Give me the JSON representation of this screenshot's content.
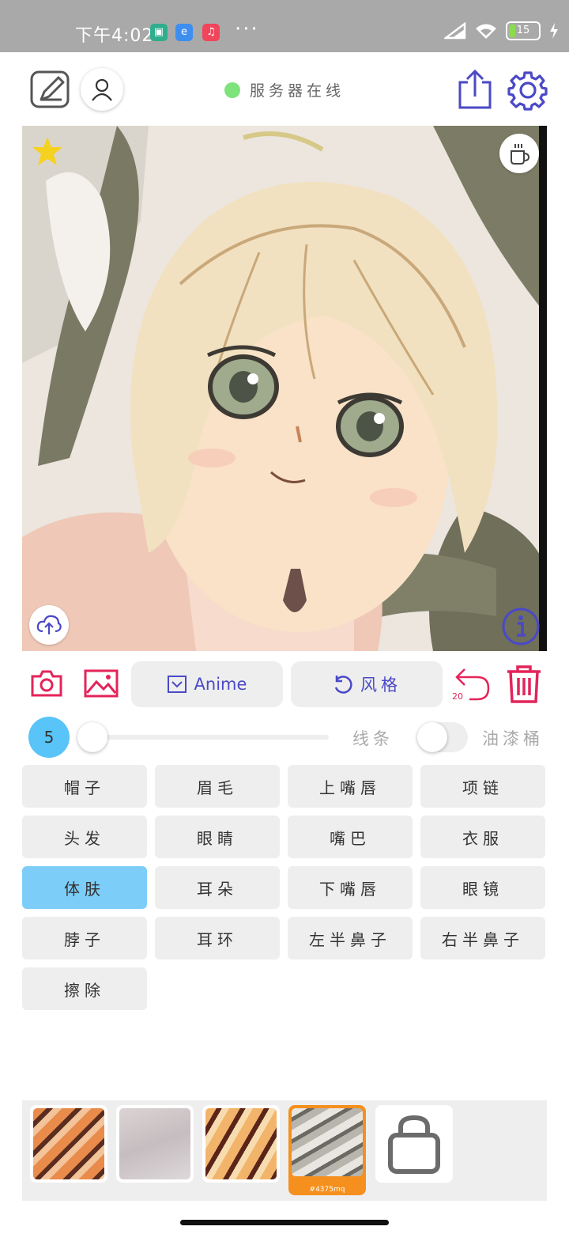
{
  "status_bar": {
    "time": "下午4:02",
    "dots": "···",
    "battery_level": "15"
  },
  "header": {
    "server_status": "服务器在线"
  },
  "toolbar": {
    "model_label": "Anime",
    "style_label": "风格",
    "undo_count": "20"
  },
  "brush": {
    "size": "5",
    "size_slider_fraction": 0.0,
    "lines_label": "线条",
    "bucket_label": "油漆桶",
    "bucket_enabled": false
  },
  "parts": [
    {
      "label": "帽子",
      "active": false
    },
    {
      "label": "眉毛",
      "active": false
    },
    {
      "label": "上嘴唇",
      "active": false
    },
    {
      "label": "项链",
      "active": false
    },
    {
      "label": "头发",
      "active": false
    },
    {
      "label": "眼睛",
      "active": false
    },
    {
      "label": "嘴巴",
      "active": false
    },
    {
      "label": "衣服",
      "active": false
    },
    {
      "label": "体肤",
      "active": true
    },
    {
      "label": "耳朵",
      "active": false
    },
    {
      "label": "下嘴唇",
      "active": false
    },
    {
      "label": "眼镜",
      "active": false
    },
    {
      "label": "脖子",
      "active": false
    },
    {
      "label": "耳环",
      "active": false
    },
    {
      "label": "左半鼻子",
      "active": false
    },
    {
      "label": "右半鼻子",
      "active": false
    },
    {
      "label": "擦除",
      "active": false
    }
  ],
  "palette": {
    "selected_caption": "#4375mq"
  },
  "colors": {
    "accent_red": "#e3245a",
    "accent_indigo": "#4b49c6",
    "active_part": "#7ccdf8",
    "server_online": "#7ee37a",
    "star": "#f5d21f"
  }
}
